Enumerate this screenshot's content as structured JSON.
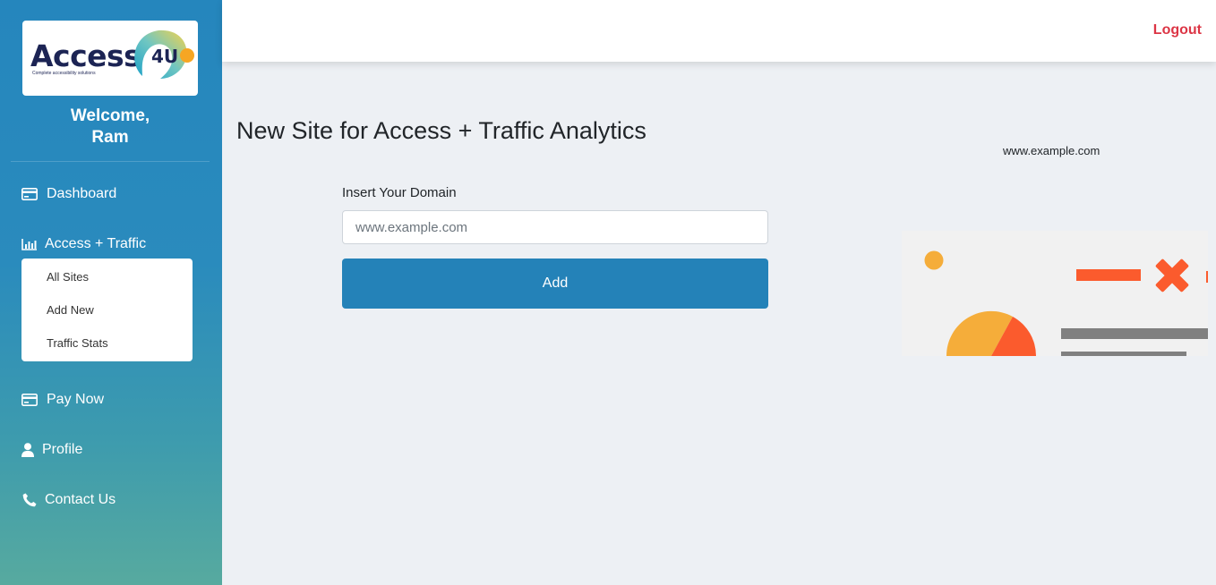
{
  "brand": {
    "name": "Access",
    "badge": "4U",
    "tagline": "Complete accessibility solutions"
  },
  "welcome": {
    "greeting": "Welcome,",
    "user": "Ram"
  },
  "nav": {
    "dashboard": "Dashboard",
    "access_traffic": "Access + Traffic",
    "submenu": [
      "All Sites",
      "Add New",
      "Traffic Stats"
    ],
    "pay_now": "Pay Now",
    "profile": "Profile",
    "contact": "Contact Us"
  },
  "topbar": {
    "logout": "Logout"
  },
  "main": {
    "title": "New Site for Access + Traffic Analytics",
    "field_label": "Insert Your Domain",
    "field_placeholder": "www.example.com",
    "add_button": "Add",
    "preview_domain": "www.example.com"
  },
  "colors": {
    "accent": "#2482b8",
    "logout": "#dc3545",
    "illustration_orange": "#fb5b2d",
    "illustration_yellow": "#f5ad3a",
    "illustration_gray": "#808080"
  }
}
